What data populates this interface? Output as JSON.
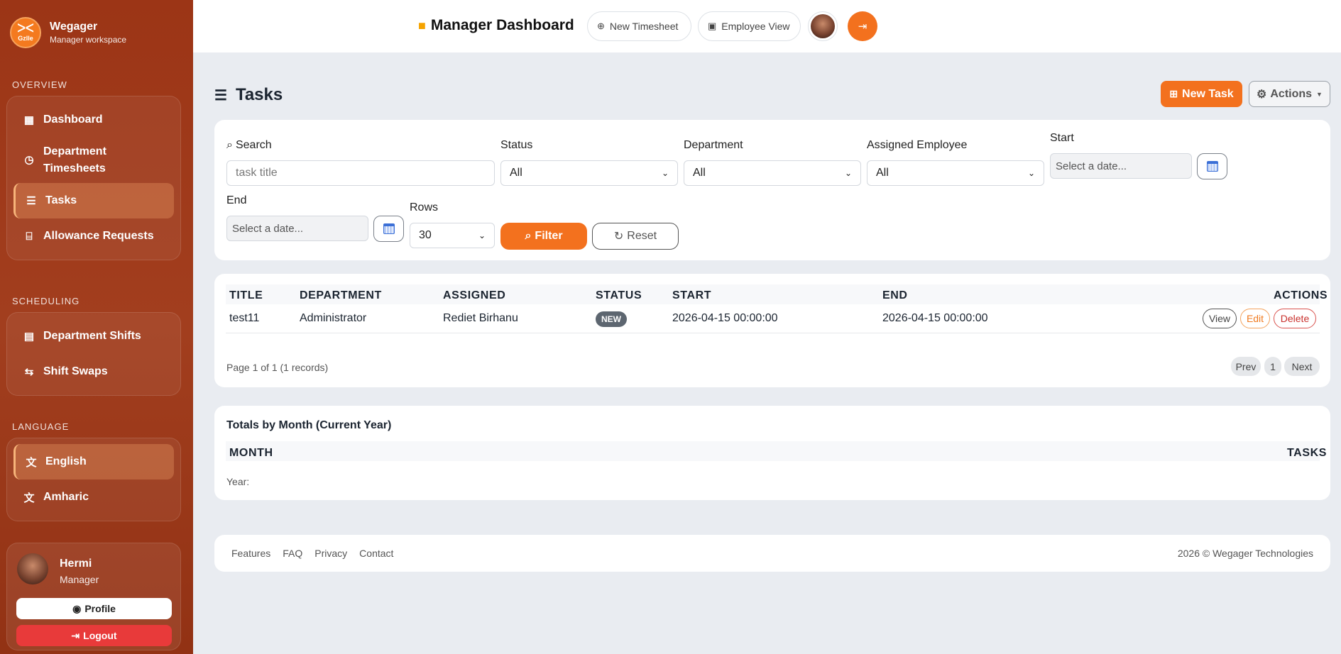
{
  "sidebar": {
    "brand_name": "Wegager",
    "brand_sub": "Manager workspace",
    "logo_text": "Gzlle",
    "sections": {
      "overview": "OVERVIEW",
      "scheduling": "SCHEDULING",
      "language": "LANGUAGE"
    },
    "overview_items": [
      {
        "label": "Dashboard",
        "icon": "dashboard-icon"
      },
      {
        "label": "Department Timesheets",
        "icon": "clock-icon"
      },
      {
        "label": "Tasks",
        "icon": "list-icon",
        "active": true
      },
      {
        "label": "Allowance Requests",
        "icon": "inbox-icon"
      }
    ],
    "scheduling_items": [
      {
        "label": "Department Shifts",
        "icon": "calendar-icon"
      },
      {
        "label": "Shift Swaps",
        "icon": "swap-icon"
      }
    ],
    "language_items": [
      {
        "label": "English",
        "icon": "translate-icon",
        "active": true
      },
      {
        "label": "Amharic",
        "icon": "translate-icon"
      }
    ],
    "user": {
      "name": "Hermi",
      "role": "Manager",
      "profile_label": "Profile",
      "logout_label": "Logout"
    }
  },
  "topbar": {
    "title": "Manager Dashboard",
    "new_timesheet": "New Timesheet",
    "employee_view": "Employee View"
  },
  "main": {
    "title": "Tasks",
    "new_task": "New Task",
    "actions": "Actions",
    "filters": {
      "search_label": "Search",
      "search_placeholder": "task title",
      "status_label": "Status",
      "status_value": "All",
      "department_label": "Department",
      "department_value": "All",
      "employee_label": "Assigned Employee",
      "employee_value": "All",
      "start_label": "Start",
      "start_placeholder": "Select a date...",
      "end_label": "End",
      "end_placeholder": "Select a date...",
      "rows_label": "Rows",
      "rows_value": "30",
      "filter_btn": "Filter",
      "reset_btn": "Reset"
    },
    "table": {
      "columns": [
        "TITLE",
        "DEPARTMENT",
        "ASSIGNED",
        "STATUS",
        "START",
        "END",
        "ACTIONS"
      ],
      "rows": [
        {
          "title": "test11",
          "department": "Administrator",
          "assigned": "Rediet Birhanu",
          "status": "NEW",
          "start": "2026-04-15 00:00:00",
          "end": "2026-04-15 00:00:00",
          "view": "View",
          "edit": "Edit",
          "delete": "Delete"
        }
      ],
      "pager_info": "Page 1 of 1 (1 records)",
      "prev": "Prev",
      "page": "1",
      "next": "Next"
    },
    "totals": {
      "title": "Totals by Month (Current Year)",
      "col_month": "MONTH",
      "col_tasks": "TASKS",
      "year_label": "Year:"
    }
  },
  "footer": {
    "links": [
      "Features",
      "FAQ",
      "Privacy",
      "Contact"
    ],
    "copyright": "2026 © Wegager Technologies"
  },
  "colors": {
    "accent": "#f3711e",
    "sidebar": "#9c3516",
    "danger": "#e83a3a"
  }
}
